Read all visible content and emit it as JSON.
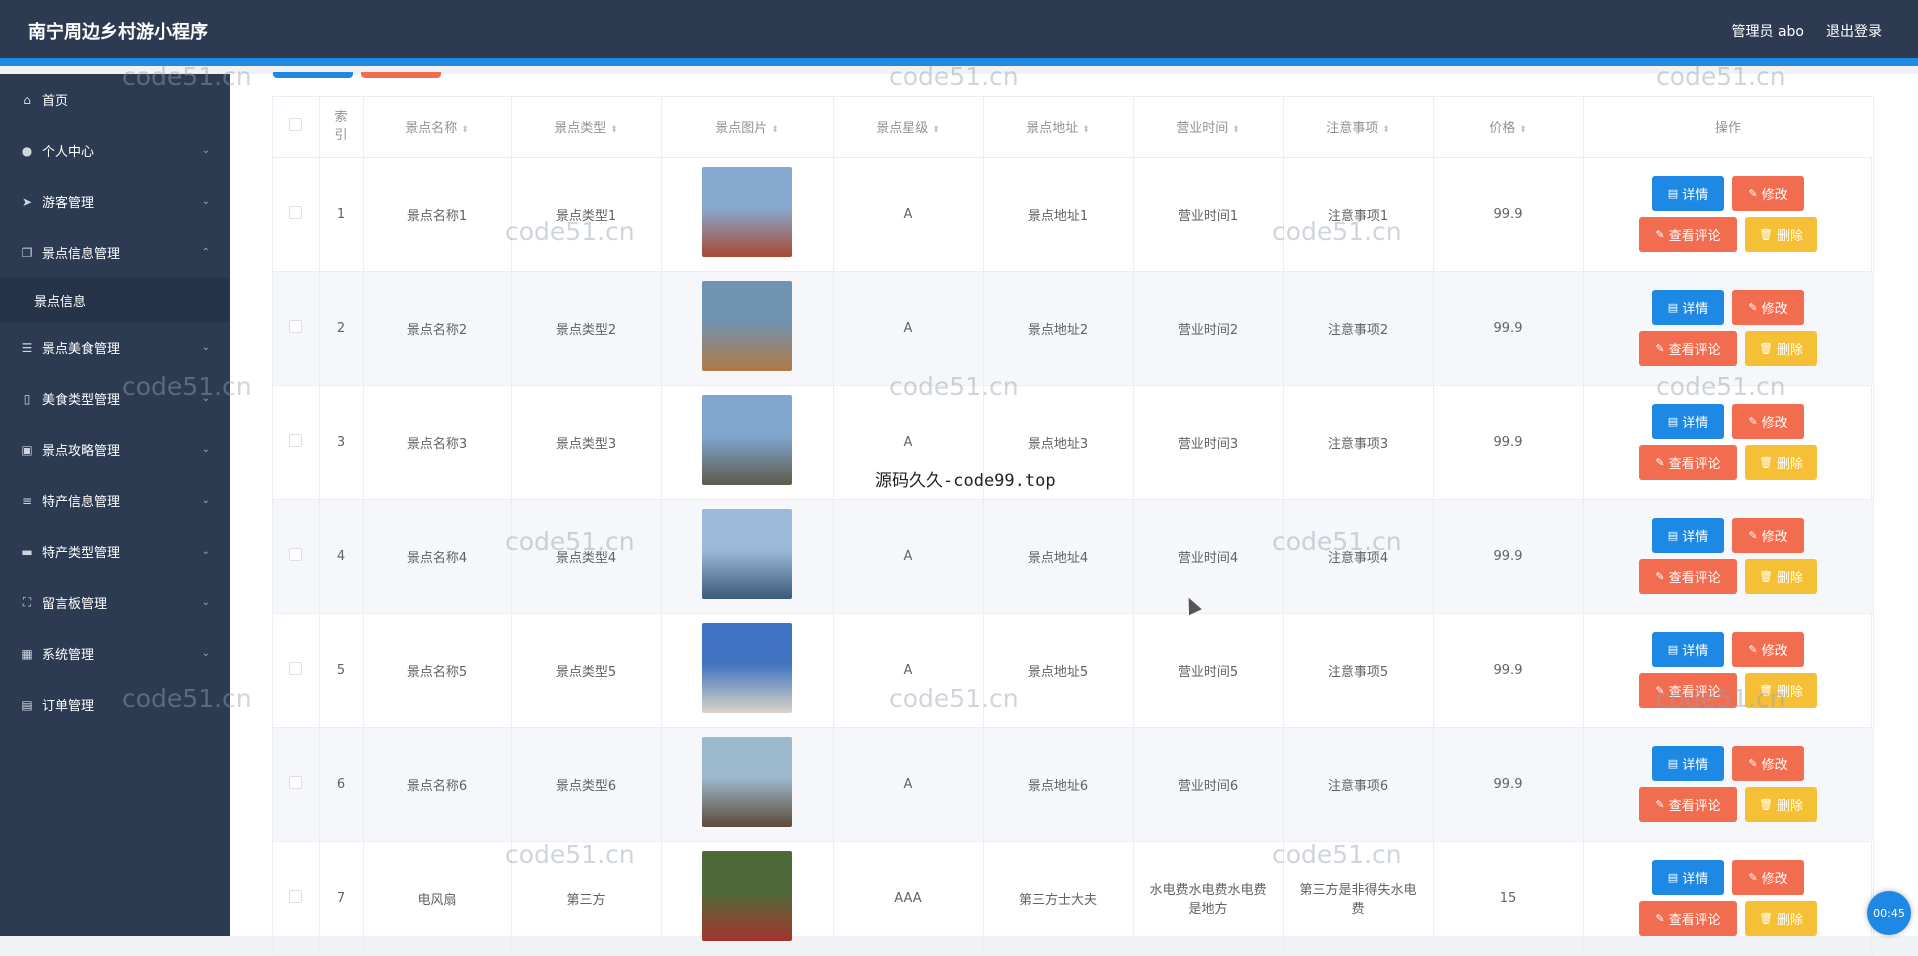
{
  "app": {
    "title": "南宁周边乡村游小程序",
    "admin_label": "管理员 abo",
    "logout_label": "退出登录"
  },
  "sidebar": {
    "items": [
      {
        "label": "首页",
        "icon": "home-icon",
        "glyph": "⌂",
        "chevron": ""
      },
      {
        "label": "个人中心",
        "icon": "user-icon",
        "glyph": "●",
        "chevron": "⌄"
      },
      {
        "label": "游客管理",
        "icon": "send-icon",
        "glyph": "➤",
        "chevron": "⌄"
      },
      {
        "label": "景点信息管理",
        "icon": "copy-icon",
        "glyph": "❐",
        "chevron": "⌃"
      },
      {
        "label": "景点美食管理",
        "icon": "sliders-icon",
        "glyph": "☰",
        "chevron": "⌄"
      },
      {
        "label": "美食类型管理",
        "icon": "mobile-icon",
        "glyph": "▯",
        "chevron": "⌄"
      },
      {
        "label": "景点攻略管理",
        "icon": "briefcase-icon",
        "glyph": "▣",
        "chevron": "⌄"
      },
      {
        "label": "特产信息管理",
        "icon": "list-icon",
        "glyph": "≡",
        "chevron": "⌄"
      },
      {
        "label": "特产类型管理",
        "icon": "box-icon",
        "glyph": "▬",
        "chevron": "⌄"
      },
      {
        "label": "留言板管理",
        "icon": "expand-icon",
        "glyph": "⛶",
        "chevron": "⌄"
      },
      {
        "label": "系统管理",
        "icon": "grid-icon",
        "glyph": "▦",
        "chevron": "⌄"
      },
      {
        "label": "订单管理",
        "icon": "clipboard-icon",
        "glyph": "▤",
        "chevron": ""
      }
    ],
    "submenu": {
      "label": "景点信息"
    }
  },
  "table": {
    "headers": [
      "索引",
      "景点名称",
      "景点类型",
      "景点图片",
      "景点星级",
      "景点地址",
      "营业时间",
      "注意事项",
      "价格",
      "操作"
    ],
    "sort_glyph": "⬍",
    "rows": [
      {
        "index": "1",
        "name": "景点名称1",
        "type": "景点类型1",
        "star": "A",
        "address": "景点地址1",
        "hours": "营业时间1",
        "notes": "注意事项1",
        "price": "99.9",
        "photo_colors": [
          "#87a9cf",
          "#a94a33"
        ]
      },
      {
        "index": "2",
        "name": "景点名称2",
        "type": "景点类型2",
        "star": "A",
        "address": "景点地址2",
        "hours": "营业时间2",
        "notes": "注意事项2",
        "price": "99.9",
        "photo_colors": [
          "#6f93b0",
          "#b07a45"
        ]
      },
      {
        "index": "3",
        "name": "景点名称3",
        "type": "景点类型3",
        "star": "A",
        "address": "景点地址3",
        "hours": "营业时间3",
        "notes": "注意事项3",
        "price": "99.9",
        "photo_colors": [
          "#7fa6cf",
          "#5f5a4c"
        ]
      },
      {
        "index": "4",
        "name": "景点名称4",
        "type": "景点类型4",
        "star": "A",
        "address": "景点地址4",
        "hours": "营业时间4",
        "notes": "注意事项4",
        "price": "99.9",
        "photo_colors": [
          "#9db9d8",
          "#3c5a7a"
        ]
      },
      {
        "index": "5",
        "name": "景点名称5",
        "type": "景点类型5",
        "star": "A",
        "address": "景点地址5",
        "hours": "营业时间5",
        "notes": "注意事项5",
        "price": "99.9",
        "photo_colors": [
          "#3f73c2",
          "#d9d4c6"
        ]
      },
      {
        "index": "6",
        "name": "景点名称6",
        "type": "景点类型6",
        "star": "A",
        "address": "景点地址6",
        "hours": "营业时间6",
        "notes": "注意事项6",
        "price": "99.9",
        "photo_colors": [
          "#9cb8cc",
          "#5e4a3a"
        ]
      },
      {
        "index": "7",
        "name": "电风扇",
        "type": "第三方",
        "star": "AAA",
        "address": "第三方士大夫",
        "hours": "水电费水电费水电费是地方",
        "notes": "第三方是非得失水电费",
        "price": "15",
        "photo_colors": [
          "#4f6a3a",
          "#a3352f"
        ]
      }
    ],
    "actions": {
      "detail": "详情",
      "edit": "修改",
      "comments": "查看评论",
      "delete": "删除"
    }
  },
  "watermarks": {
    "small": "code51.cn",
    "center": "源码久久-code99.top"
  },
  "timer": {
    "label": "00:45"
  },
  "colors": {
    "header_bg": "#2c3b52",
    "accent": "#1e88e5",
    "danger": "#f26c4f",
    "warning": "#f6c036"
  }
}
